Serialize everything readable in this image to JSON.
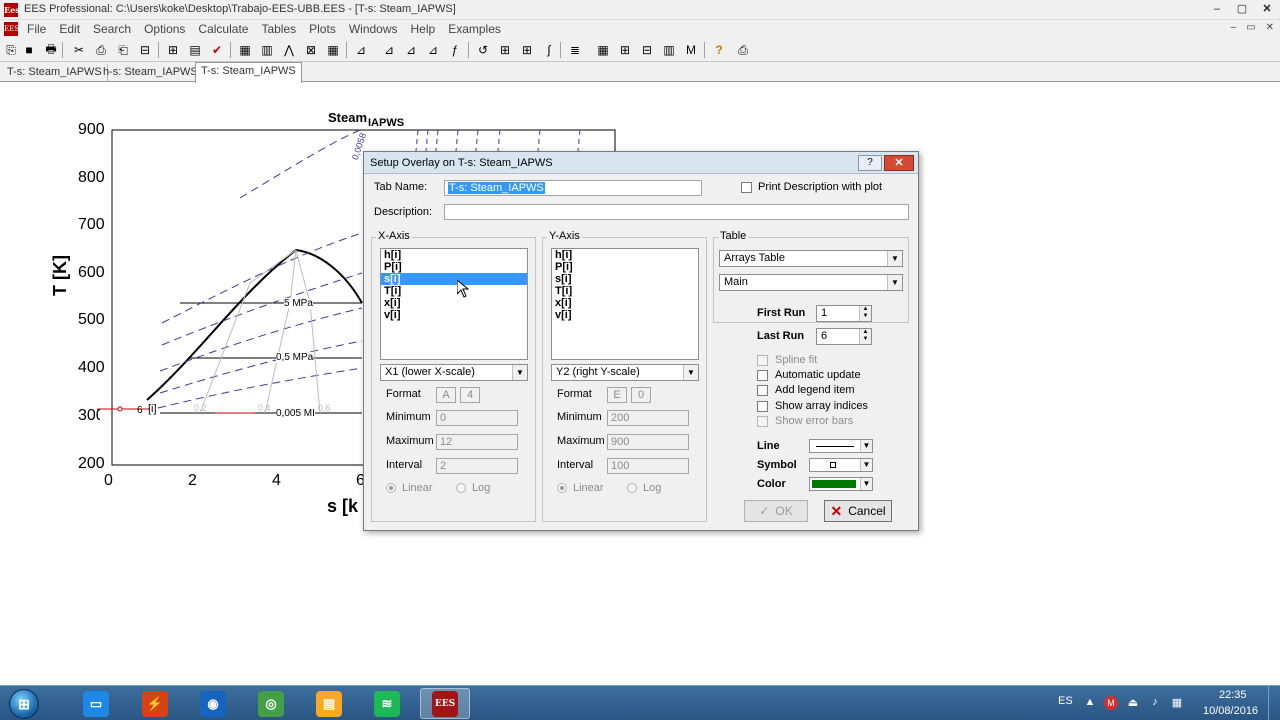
{
  "window": {
    "title": "EES Professional:  C:\\Users\\koke\\Desktop\\Trabajo-EES-UBB.EES - [T-s: Steam_IAPWS]",
    "app_icon_text": "Ees",
    "minimize": "–",
    "maximize": "▢",
    "close": "✕"
  },
  "menu": {
    "icon_text": "EES",
    "items": [
      "File",
      "Edit",
      "Search",
      "Options",
      "Calculate",
      "Tables",
      "Plots",
      "Windows",
      "Help",
      "Examples"
    ],
    "mdi_controls": [
      "–",
      "▭",
      "✕"
    ]
  },
  "toolbar": {
    "icons": [
      "open-folder-icon",
      "save-icon",
      "print-icon",
      "cut-icon",
      "paste-icon",
      "copy-icon",
      "equations-window-icon",
      "formatted-equations-icon",
      "solution-window-icon",
      "check-icon",
      "calculator-icon",
      "parametric-table-icon",
      "plot-window-icon",
      "diagram-window-icon",
      "table-icon",
      "new-plot-icon",
      "overlay-plot-icon",
      "property-plot-icon",
      "edit-plot-icon",
      "function-info-icon",
      "unit-conversion-icon",
      "array-table-icon",
      "lookup-table-icon",
      "integral-table-icon",
      "report-icon",
      "grid-icon",
      "map-icon",
      "chart-icon",
      "bar-chart-icon",
      "macro-icon",
      "help-icon",
      "diagram-icon"
    ],
    "labels": [
      "⎘",
      "■",
      "🖶",
      "✂",
      "⎙",
      "⎗",
      "⊟",
      "⊞",
      "▤",
      "✔",
      "▦",
      "▥",
      "⋀",
      "⊠",
      "▦",
      "⊿",
      "⊿",
      "⊿",
      "⊿",
      "ƒ",
      "↺",
      "⊞",
      "⊞",
      "∫",
      "≣",
      "▦",
      "⊞",
      "⊟",
      "▥",
      "M",
      "?",
      "⎙"
    ]
  },
  "tabs": [
    "T-s: Steam_IAPWS",
    "h-s: Steam_IAPWS",
    "T-s: Steam_IAPWS"
  ],
  "plot": {
    "title": "Steam",
    "title_subscript": "IAPWS",
    "y_label": "T [K]",
    "x_label": "s [k",
    "y_ticks": [
      "900",
      "800",
      "700",
      "600",
      "500",
      "400",
      "300",
      "200"
    ],
    "x_ticks": [
      "0",
      "2",
      "4",
      "6"
    ],
    "pressure_labels": [
      "5 MPa",
      "0,5 MPa",
      "0,005 MI"
    ],
    "quality_labels": [
      "0,2",
      "0,4",
      "0,6"
    ],
    "volume_label": "0,0058",
    "point_label": "6",
    "array_label": "[i]"
  },
  "dialog": {
    "title": "Setup Overlay on T-s: Steam_IAPWS",
    "help": "?",
    "close": "✕",
    "tab_name_label": "Tab Name:",
    "tab_name_value": "T-s: Steam_IAPWS",
    "print_desc_label": "Print Description with plot",
    "description_label": "Description:",
    "description_value": "",
    "x_axis": {
      "legend": "X-Axis",
      "items": [
        "h[i]",
        "P[i]",
        "s[i]",
        "T[i]",
        "x[i]",
        "v[i]"
      ],
      "selected_index": 2,
      "scale": "X1 (lower X-scale)",
      "format_label": "Format",
      "format_a": "A",
      "format_b": "4",
      "minimum_label": "Minimum",
      "minimum": "0",
      "maximum_label": "Maximum",
      "maximum": "12",
      "interval_label": "Interval",
      "interval": "2",
      "linear_label": "Linear",
      "log_label": "Log"
    },
    "y_axis": {
      "legend": "Y-Axis",
      "items": [
        "h[i]",
        "P[i]",
        "s[i]",
        "T[i]",
        "x[i]",
        "v[i]"
      ],
      "scale": "Y2 (right Y-scale)",
      "format_label": "Format",
      "format_a": "E",
      "format_b": "0",
      "minimum_label": "Minimum",
      "minimum": "200",
      "maximum_label": "Maximum",
      "maximum": "900",
      "interval_label": "Interval",
      "interval": "100",
      "linear_label": "Linear",
      "log_label": "Log"
    },
    "table": {
      "legend": "Table",
      "table_select": "Arrays Table",
      "subtable_select": "Main",
      "first_run_label": "First Run",
      "first_run": "1",
      "last_run_label": "Last Run",
      "last_run": "6",
      "spline_label": "Spline fit",
      "auto_update_label": "Automatic update",
      "legend_item_label": "Add legend item",
      "array_indices_label": "Show array indices",
      "error_bars_label": "Show error bars",
      "line_label": "Line",
      "symbol_label": "Symbol",
      "color_label": "Color",
      "color_value": "#007700"
    },
    "ok_label": "OK",
    "cancel_label": "Cancel"
  },
  "taskbar": {
    "start_label": "⊞",
    "apps": [
      {
        "name": "remote-desktop-icon",
        "glyph": "▭",
        "color": "#1e88e5"
      },
      {
        "name": "power-app-icon",
        "glyph": "⚡",
        "color": "#d84315"
      },
      {
        "name": "firefox-icon",
        "glyph": "◉",
        "color": "#1565c0"
      },
      {
        "name": "chrome-icon",
        "glyph": "◎",
        "color": "#43a047"
      },
      {
        "name": "explorer-icon",
        "glyph": "▤",
        "color": "#f9a825"
      },
      {
        "name": "spotify-icon",
        "glyph": "≋",
        "color": "#1db954"
      },
      {
        "name": "ees-icon",
        "glyph": "EES",
        "color": "#a31515"
      }
    ],
    "language": "ES",
    "time": "22:35",
    "date": "10/08/2016"
  }
}
